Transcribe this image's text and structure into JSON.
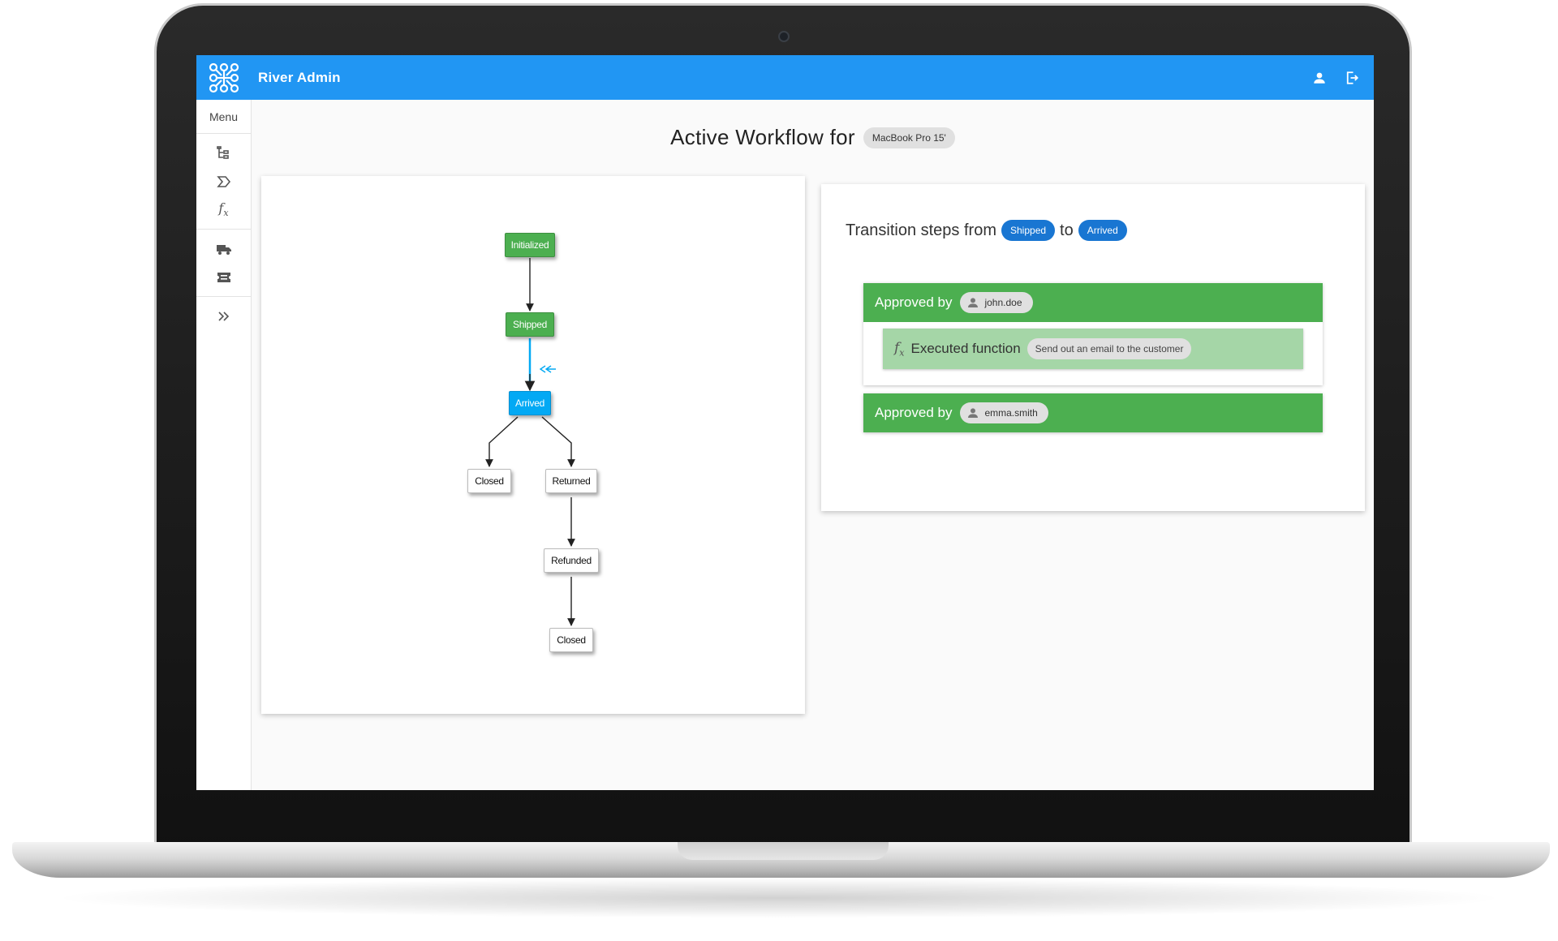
{
  "app": {
    "title": "River Admin"
  },
  "sidebar": {
    "menu_label": "Menu"
  },
  "page": {
    "title": "Active Workflow for",
    "object_chip": "MacBook Pro 15'"
  },
  "diagram": {
    "nodes": [
      {
        "label": "Initialized",
        "status": "passed"
      },
      {
        "label": "Shipped",
        "status": "passed"
      },
      {
        "label": "Arrived",
        "status": "current"
      },
      {
        "label": "Closed",
        "status": "pending"
      },
      {
        "label": "Returned",
        "status": "pending"
      },
      {
        "label": "Refunded",
        "status": "pending"
      },
      {
        "label": "Closed",
        "status": "pending"
      }
    ],
    "edges": [
      [
        "Initialized",
        "Shipped"
      ],
      [
        "Shipped",
        "Arrived"
      ],
      [
        "Arrived",
        "Closed"
      ],
      [
        "Arrived",
        "Returned"
      ],
      [
        "Returned",
        "Refunded"
      ],
      [
        "Refunded",
        "Closed"
      ]
    ]
  },
  "transition": {
    "heading": "Transition steps from",
    "from_chip": "Shipped",
    "to_word": "to",
    "to_chip": "Arrived",
    "steps": [
      {
        "label": "Approved by",
        "user": "john.doe",
        "function_label": "Executed function",
        "function_chip": "Send out an email to the customer"
      },
      {
        "label": "Approved by",
        "user": "emma.smith"
      }
    ]
  },
  "colors": {
    "primary": "#2196f3",
    "passed": "#4caf50",
    "current": "#03a9f4",
    "chip_blue": "#1976d2",
    "function_row": "#a5d6a7"
  },
  "icons": [
    "workflow-logo-icon",
    "account-icon",
    "logout-icon",
    "states-icon",
    "transitions-icon",
    "function-icon",
    "truck-icon",
    "ticket-icon",
    "expand-icon"
  ]
}
